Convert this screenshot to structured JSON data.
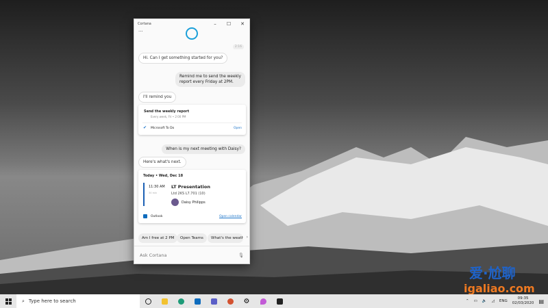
{
  "window": {
    "title": "Cortana",
    "minimize": "–",
    "maximize": "☐",
    "close": "✕",
    "more": "···",
    "timestamp": "2:16"
  },
  "messages": [
    {
      "from": "cortana",
      "text": "Hi. Can I get something started for you?"
    },
    {
      "from": "user",
      "text": "Remind me to send the weekly report every Friday at 2PM."
    },
    {
      "from": "cortana",
      "text": "I'll remind you"
    },
    {
      "from": "user",
      "text": "When is my next meeting with Daisy?"
    },
    {
      "from": "cortana",
      "text": "Here's what's next."
    }
  ],
  "reminder_card": {
    "title": "Send the weekly report",
    "subtitle": "Every week, Fri • 2:00 PM",
    "app": "Microsoft To Do",
    "action": "Open"
  },
  "meeting_card": {
    "date": "Today • Wed, Dec 18",
    "time": "11:30 AM",
    "duration": "30 min",
    "title": "LT Presentation",
    "location": "Ltd 2KS L7.701 (10)",
    "attendee": "Daisy Philipps",
    "app": "Outlook",
    "action": "Open calendar",
    "accent": "#1a5fb4"
  },
  "suggestions": [
    "Am I free at 2 PM",
    "Open Teams",
    "What's the weather"
  ],
  "input": {
    "placeholder": "Ask Cortana"
  },
  "taskbar": {
    "search_placeholder": "Type here to search",
    "apps": [
      "cortana-icon",
      "file-explorer-icon",
      "edge-icon",
      "outlook-icon",
      "teams-icon",
      "powerpoint-icon",
      "settings-icon",
      "paint-icon",
      "store-icon"
    ],
    "lang": "ENG",
    "time": "09:35",
    "date": "02/03/2020"
  },
  "watermark": {
    "cn": "爱·尬聊",
    "url": "igaliao.com"
  },
  "colors": {
    "cortana": "#1a9fd9",
    "link": "#1a73c8"
  }
}
